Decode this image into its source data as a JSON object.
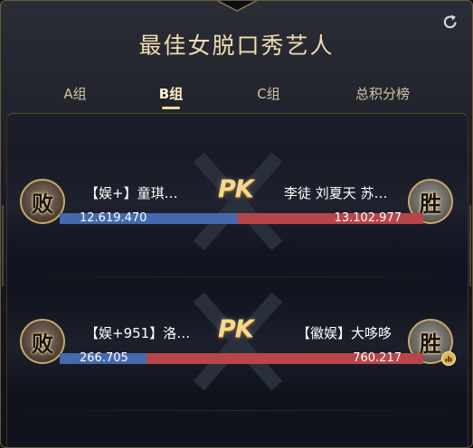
{
  "header": {
    "title": "最佳女脱口秀艺人"
  },
  "tabs": [
    {
      "label": "A组",
      "active": false
    },
    {
      "label": "B组",
      "active": true
    },
    {
      "label": "C组",
      "active": false
    },
    {
      "label": "总积分榜",
      "active": false
    }
  ],
  "matches": [
    {
      "left": {
        "name": "【娱+】童琪…",
        "result": "败",
        "score": "12.619.470"
      },
      "right": {
        "name": "李徒 刘夏天 苏…",
        "result": "胜",
        "score": "13.102.977"
      },
      "pk_label": "PK",
      "left_share": 0.49
    },
    {
      "left": {
        "name": "【娱+951】洛…",
        "result": "败",
        "score": "266.705"
      },
      "right": {
        "name": "【徽娱】大哆哆",
        "result": "胜",
        "score": "760.217"
      },
      "pk_label": "PK",
      "left_share": 0.24
    }
  ],
  "colors": {
    "accent": "#f0d79c",
    "left_bar": "#4669ad",
    "right_bar": "#b64649"
  },
  "icons": [
    "refresh-icon",
    "chart-badge-icon"
  ]
}
